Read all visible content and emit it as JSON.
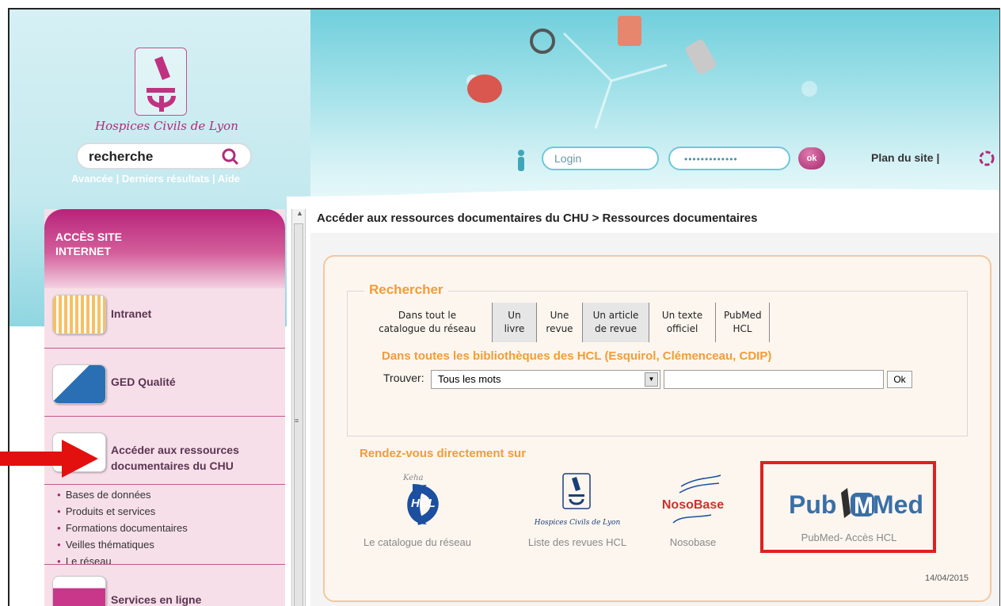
{
  "header": {
    "logo_text": "Hospices Civils de Lyon",
    "search_value": "recherche",
    "search_links": [
      "Avancée",
      "Derniers résultats",
      "Aide"
    ],
    "login_placeholder": "Login",
    "password_mask": "•••••••••••••",
    "ok_label": "ok",
    "site_map": "Plan du site |"
  },
  "sidebar": {
    "section_title_line1": "ACCÈS SITE",
    "section_title_line2": "INTERNET",
    "items": [
      {
        "label": "Intranet"
      },
      {
        "label": "GED Qualité"
      },
      {
        "label_line1": "Accéder aux ressources",
        "label_line2": "documentaires du CHU"
      },
      {
        "label": "Services en ligne"
      }
    ],
    "sub_items": [
      "Bases de données",
      "Produits et services",
      "Formations documentaires",
      "Veilles thématiques",
      "Le réseau"
    ]
  },
  "breadcrumb": "Accéder aux ressources documentaires du CHU > Ressources documentaires",
  "search_panel": {
    "legend": "Rechercher",
    "tabs": [
      {
        "line1": "Dans tout le",
        "line2": "catalogue du réseau"
      },
      {
        "line1": "Un",
        "line2": "livre"
      },
      {
        "line1": "Une",
        "line2": "revue"
      },
      {
        "line1": "Un article",
        "line2": "de revue"
      },
      {
        "line1": "Un texte",
        "line2": "officiel"
      },
      {
        "line1": "PubMed",
        "line2": "HCL"
      }
    ],
    "subheading": "Dans toutes les bibliothèques des HCL (Esquirol, Clémenceau, CDIP)",
    "find_label": "Trouver:",
    "select_value": "Tous les mots",
    "ok_label": "Ok"
  },
  "direct": {
    "title": "Rendez-vous directement sur",
    "resources": [
      {
        "logo_top": "Keha",
        "logo_text": "HCL",
        "caption": "Le catalogue du réseau"
      },
      {
        "logo_text": "Hospices Civils de Lyon",
        "caption": "Liste des revues HCL"
      },
      {
        "logo_text": "NosoBase",
        "caption": "Nosobase"
      },
      {
        "logo_text_a": "Pub",
        "logo_text_b": "Med",
        "caption": "PubMed- Accès HCL"
      }
    ]
  },
  "date": "14/04/2015",
  "colors": {
    "accent": "#f39c36",
    "brand": "#b02b7a",
    "highlight": "#e02020"
  }
}
